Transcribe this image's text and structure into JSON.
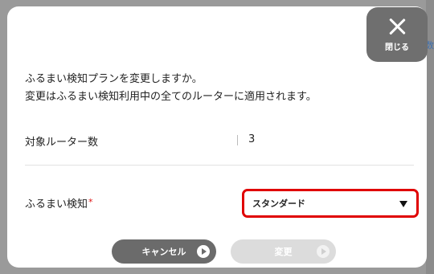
{
  "backdrop": {
    "partial_text": "数"
  },
  "dialog": {
    "close_label": "閉じる",
    "message_lines": [
      "ふるまい検知プランを変更しますか。",
      "変更はふるまい検知利用中の全てのルーターに適用されます。"
    ],
    "target_router_count_label": "対象ルーター数",
    "target_router_count_value": "3",
    "plan_label": "ふるまい検知",
    "plan_required_mark": "*",
    "plan_select_value": "スタンダード",
    "cancel_label": "キャンセル",
    "change_label": "変更"
  },
  "colors": {
    "close_bg": "#6f6f6f",
    "highlight_border": "#e00000",
    "cancel_bg": "#6b6b6b",
    "change_disabled_bg": "#dcdcdc",
    "required_mark": "#d11111"
  },
  "icons": {
    "close": "close-x-icon",
    "caret": "caret-down-icon",
    "arrow": "play-arrow-icon"
  }
}
